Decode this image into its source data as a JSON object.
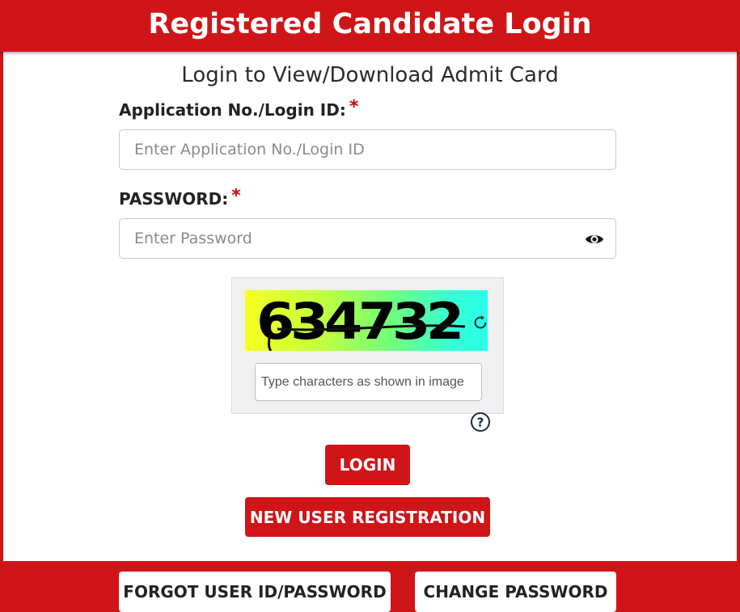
{
  "header": {
    "title": "Registered Candidate Login"
  },
  "form": {
    "subtitle": "Login to View/Download Admit Card",
    "login_id": {
      "label": "Application No./Login ID:",
      "required_marker": "*",
      "placeholder": "Enter Application No./Login ID",
      "value": ""
    },
    "password": {
      "label": "PASSWORD:",
      "required_marker": "*",
      "placeholder": "Enter Password",
      "value": "",
      "toggle_icon": "eye-icon"
    },
    "captcha": {
      "code": "634732",
      "placeholder": "Type characters as shown in image",
      "value": "",
      "refresh_icon": "refresh-icon",
      "help_icon": "help-icon"
    },
    "login_button": "LOGIN",
    "register_button": "NEW USER REGISTRATION"
  },
  "footer": {
    "forgot_button": "FORGOT USER ID/PASSWORD",
    "change_password_button": "CHANGE PASSWORD"
  },
  "colors": {
    "brand_red": "#cf1518",
    "required_red": "#d40000",
    "text_dark": "#222222"
  }
}
